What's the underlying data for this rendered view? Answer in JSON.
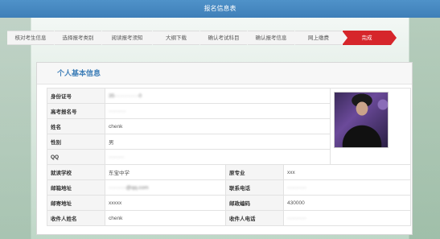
{
  "header": {
    "title": "报名信息表"
  },
  "steps": [
    {
      "label": "核对考生信息",
      "active": false
    },
    {
      "label": "选择报考类别",
      "active": false
    },
    {
      "label": "阅读报考须知",
      "active": false
    },
    {
      "label": "大纲下载",
      "active": false
    },
    {
      "label": "确认考试科目",
      "active": false
    },
    {
      "label": "确认报考信息",
      "active": false
    },
    {
      "label": "网上缴费",
      "active": false
    },
    {
      "label": "完成",
      "active": true
    }
  ],
  "panel": {
    "title": "个人基本信息",
    "rows": {
      "id_card": {
        "label": "身份证号",
        "value": "35··············0"
      },
      "exam_no": {
        "label": "高考报名号",
        "value": "··········"
      },
      "name": {
        "label": "姓名",
        "value": "chenk"
      },
      "gender": {
        "label": "性别",
        "value": "男"
      },
      "qq": {
        "label": "QQ",
        "value": "·········"
      },
      "school": {
        "label": "就读学校",
        "value": "东宝中学"
      },
      "major": {
        "label": "原专业",
        "value": "xxx"
      },
      "email": {
        "label": "邮箱地址",
        "value": "··········@qq.com"
      },
      "phone": {
        "label": "联系电话",
        "value": "···········"
      },
      "address": {
        "label": "邮寄地址",
        "value": "xxxxx"
      },
      "postcode": {
        "label": "邮政编码",
        "value": "430000"
      },
      "receiver_name": {
        "label": "收件人姓名",
        "value": "chenk"
      },
      "receiver_phone": {
        "label": "收件人电话",
        "value": "···········"
      }
    }
  }
}
